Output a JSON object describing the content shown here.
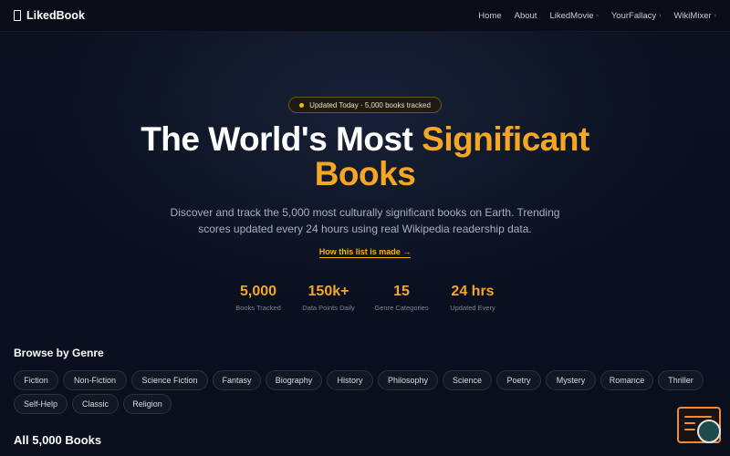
{
  "nav": {
    "brand": "LikedBook",
    "links": [
      {
        "label": "Home",
        "dropdown": false
      },
      {
        "label": "About",
        "dropdown": false
      },
      {
        "label": "LikedMovie",
        "dropdown": true
      },
      {
        "label": "YourFallacy",
        "dropdown": true
      },
      {
        "label": "WikiMixer",
        "dropdown": true
      }
    ]
  },
  "hero": {
    "badge": "Updated Today · 5,000 books tracked",
    "title_white": "The World's Most ",
    "title_highlight": "Significant",
    "title_line2": "Books",
    "subtitle_line1": "Discover and track the 5,000 most culturally significant books on Earth. Trending",
    "subtitle_line2": "scores updated every 24 hours using real Wikipedia readership data.",
    "link": "How this list is made →"
  },
  "stats": [
    {
      "value": "5,000",
      "label": "Books Tracked"
    },
    {
      "value": "150k+",
      "label": "Data Points Daily"
    },
    {
      "value": "15",
      "label": "Genre Categories"
    },
    {
      "value": "24 hrs",
      "label": "Updated Every"
    }
  ],
  "genres": {
    "heading": "Browse by Genre",
    "items": [
      "Fiction",
      "Non-Fiction",
      "Science Fiction",
      "Fantasy",
      "Biography",
      "History",
      "Philosophy",
      "Science",
      "Poetry",
      "Mystery",
      "Romance",
      "Thriller",
      "Self-Help",
      "Classic",
      "Religion"
    ]
  },
  "books": {
    "heading": "All 5,000 Books"
  },
  "colors": {
    "accent": "#f5a623",
    "background": "#0b1020",
    "badge_dot": "#f5b800"
  }
}
